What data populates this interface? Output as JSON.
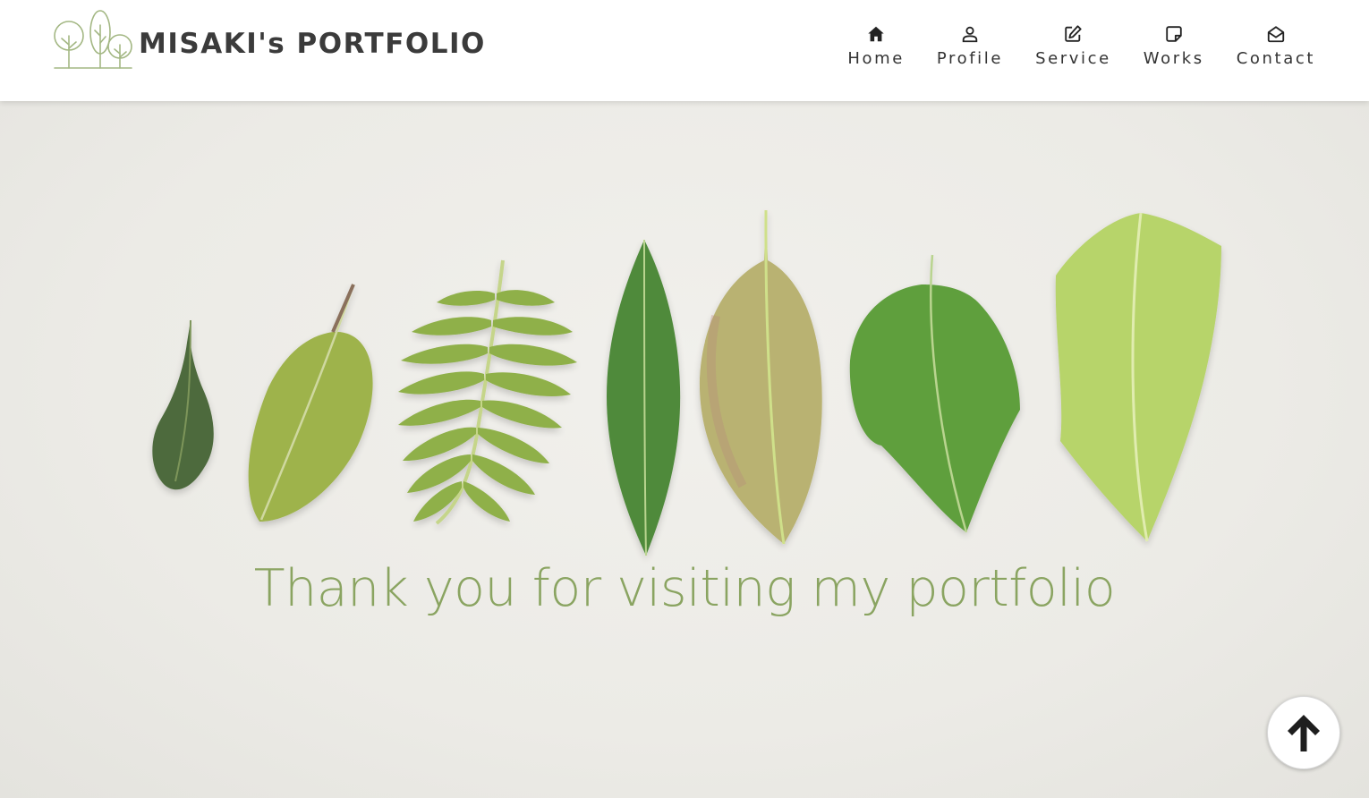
{
  "header": {
    "logo_text": "MISAKI's PORTFOLIO",
    "logo_icon": "trees-logo-icon",
    "nav": [
      {
        "label": "Home",
        "icon": "home-icon"
      },
      {
        "label": "Profile",
        "icon": "user-icon"
      },
      {
        "label": "Service",
        "icon": "edit-icon"
      },
      {
        "label": "Works",
        "icon": "note-icon"
      },
      {
        "label": "Contact",
        "icon": "envelope-open-icon"
      }
    ]
  },
  "hero": {
    "headline": "Thank you for visiting my portfolio",
    "image": "seven-green-leaves-in-a-row"
  },
  "scroll_top": {
    "icon": "arrow-up-icon"
  },
  "colors": {
    "accent_green": "#8aa461",
    "header_text": "#333333",
    "background": "#ecebe6"
  }
}
